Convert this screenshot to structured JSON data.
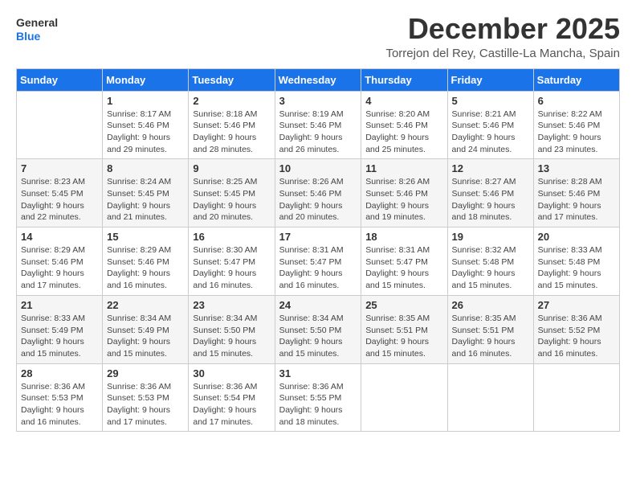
{
  "logo": {
    "line1": "General",
    "line2": "Blue"
  },
  "title": "December 2025",
  "subtitle": "Torrejon del Rey, Castille-La Mancha, Spain",
  "weekdays": [
    "Sunday",
    "Monday",
    "Tuesday",
    "Wednesday",
    "Thursday",
    "Friday",
    "Saturday"
  ],
  "weeks": [
    [
      {
        "day": "",
        "info": ""
      },
      {
        "day": "1",
        "info": "Sunrise: 8:17 AM\nSunset: 5:46 PM\nDaylight: 9 hours\nand 29 minutes."
      },
      {
        "day": "2",
        "info": "Sunrise: 8:18 AM\nSunset: 5:46 PM\nDaylight: 9 hours\nand 28 minutes."
      },
      {
        "day": "3",
        "info": "Sunrise: 8:19 AM\nSunset: 5:46 PM\nDaylight: 9 hours\nand 26 minutes."
      },
      {
        "day": "4",
        "info": "Sunrise: 8:20 AM\nSunset: 5:46 PM\nDaylight: 9 hours\nand 25 minutes."
      },
      {
        "day": "5",
        "info": "Sunrise: 8:21 AM\nSunset: 5:46 PM\nDaylight: 9 hours\nand 24 minutes."
      },
      {
        "day": "6",
        "info": "Sunrise: 8:22 AM\nSunset: 5:46 PM\nDaylight: 9 hours\nand 23 minutes."
      }
    ],
    [
      {
        "day": "7",
        "info": "Sunrise: 8:23 AM\nSunset: 5:45 PM\nDaylight: 9 hours\nand 22 minutes."
      },
      {
        "day": "8",
        "info": "Sunrise: 8:24 AM\nSunset: 5:45 PM\nDaylight: 9 hours\nand 21 minutes."
      },
      {
        "day": "9",
        "info": "Sunrise: 8:25 AM\nSunset: 5:45 PM\nDaylight: 9 hours\nand 20 minutes."
      },
      {
        "day": "10",
        "info": "Sunrise: 8:26 AM\nSunset: 5:46 PM\nDaylight: 9 hours\nand 20 minutes."
      },
      {
        "day": "11",
        "info": "Sunrise: 8:26 AM\nSunset: 5:46 PM\nDaylight: 9 hours\nand 19 minutes."
      },
      {
        "day": "12",
        "info": "Sunrise: 8:27 AM\nSunset: 5:46 PM\nDaylight: 9 hours\nand 18 minutes."
      },
      {
        "day": "13",
        "info": "Sunrise: 8:28 AM\nSunset: 5:46 PM\nDaylight: 9 hours\nand 17 minutes."
      }
    ],
    [
      {
        "day": "14",
        "info": "Sunrise: 8:29 AM\nSunset: 5:46 PM\nDaylight: 9 hours\nand 17 minutes."
      },
      {
        "day": "15",
        "info": "Sunrise: 8:29 AM\nSunset: 5:46 PM\nDaylight: 9 hours\nand 16 minutes."
      },
      {
        "day": "16",
        "info": "Sunrise: 8:30 AM\nSunset: 5:47 PM\nDaylight: 9 hours\nand 16 minutes."
      },
      {
        "day": "17",
        "info": "Sunrise: 8:31 AM\nSunset: 5:47 PM\nDaylight: 9 hours\nand 16 minutes."
      },
      {
        "day": "18",
        "info": "Sunrise: 8:31 AM\nSunset: 5:47 PM\nDaylight: 9 hours\nand 15 minutes."
      },
      {
        "day": "19",
        "info": "Sunrise: 8:32 AM\nSunset: 5:48 PM\nDaylight: 9 hours\nand 15 minutes."
      },
      {
        "day": "20",
        "info": "Sunrise: 8:33 AM\nSunset: 5:48 PM\nDaylight: 9 hours\nand 15 minutes."
      }
    ],
    [
      {
        "day": "21",
        "info": "Sunrise: 8:33 AM\nSunset: 5:49 PM\nDaylight: 9 hours\nand 15 minutes."
      },
      {
        "day": "22",
        "info": "Sunrise: 8:34 AM\nSunset: 5:49 PM\nDaylight: 9 hours\nand 15 minutes."
      },
      {
        "day": "23",
        "info": "Sunrise: 8:34 AM\nSunset: 5:50 PM\nDaylight: 9 hours\nand 15 minutes."
      },
      {
        "day": "24",
        "info": "Sunrise: 8:34 AM\nSunset: 5:50 PM\nDaylight: 9 hours\nand 15 minutes."
      },
      {
        "day": "25",
        "info": "Sunrise: 8:35 AM\nSunset: 5:51 PM\nDaylight: 9 hours\nand 15 minutes."
      },
      {
        "day": "26",
        "info": "Sunrise: 8:35 AM\nSunset: 5:51 PM\nDaylight: 9 hours\nand 16 minutes."
      },
      {
        "day": "27",
        "info": "Sunrise: 8:36 AM\nSunset: 5:52 PM\nDaylight: 9 hours\nand 16 minutes."
      }
    ],
    [
      {
        "day": "28",
        "info": "Sunrise: 8:36 AM\nSunset: 5:53 PM\nDaylight: 9 hours\nand 16 minutes."
      },
      {
        "day": "29",
        "info": "Sunrise: 8:36 AM\nSunset: 5:53 PM\nDaylight: 9 hours\nand 17 minutes."
      },
      {
        "day": "30",
        "info": "Sunrise: 8:36 AM\nSunset: 5:54 PM\nDaylight: 9 hours\nand 17 minutes."
      },
      {
        "day": "31",
        "info": "Sunrise: 8:36 AM\nSunset: 5:55 PM\nDaylight: 9 hours\nand 18 minutes."
      },
      {
        "day": "",
        "info": ""
      },
      {
        "day": "",
        "info": ""
      },
      {
        "day": "",
        "info": ""
      }
    ]
  ]
}
